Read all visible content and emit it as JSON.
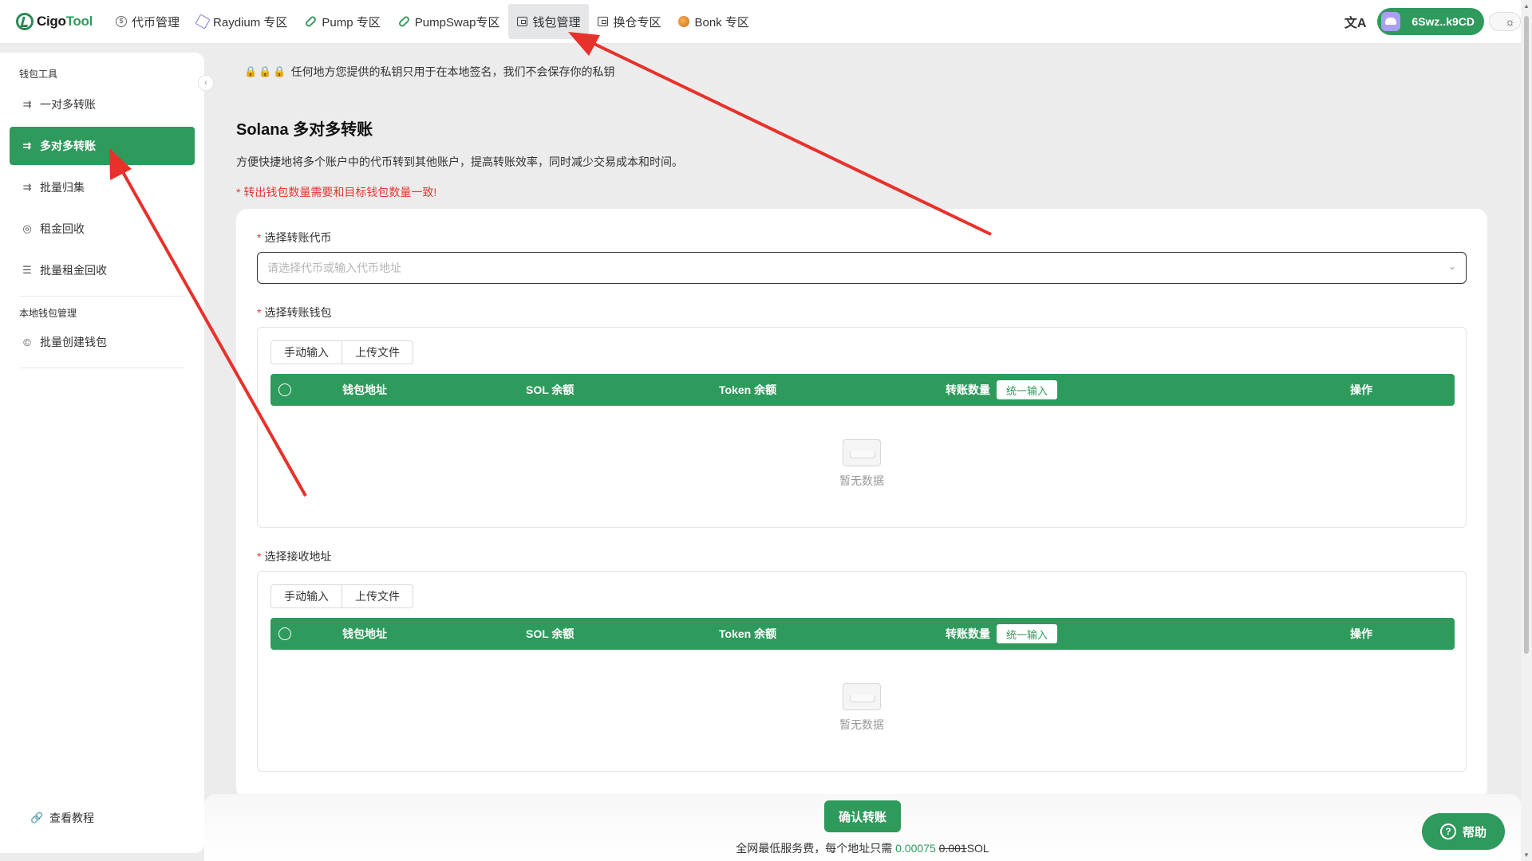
{
  "app": {
    "logo_part1": "Cigo",
    "logo_part2": "Tool"
  },
  "nav": [
    {
      "label": "代币管理",
      "icon": "dollar-circle-icon"
    },
    {
      "label": "Raydium 专区",
      "icon": "raydium-icon"
    },
    {
      "label": "Pump 专区",
      "icon": "pill-icon"
    },
    {
      "label": "PumpSwap专区",
      "icon": "pill-icon"
    },
    {
      "label": "钱包管理",
      "icon": "wallet-icon",
      "active": true
    },
    {
      "label": "换仓专区",
      "icon": "wallet-icon"
    },
    {
      "label": "Bonk 专区",
      "icon": "bonk-icon"
    }
  ],
  "wallet": {
    "address": "6Swz..k9CD"
  },
  "sidebar": {
    "section1": "钱包工具",
    "items": [
      {
        "label": "一对多转账",
        "icon": "transfer-icon"
      },
      {
        "label": "多对多转账",
        "icon": "transfer-icon",
        "active": true
      },
      {
        "label": "批量归集",
        "icon": "transfer-icon"
      },
      {
        "label": "租金回收",
        "icon": "coin-icon"
      },
      {
        "label": "批量租金回收",
        "icon": "coins-icon"
      }
    ],
    "section2": "本地钱包管理",
    "items2": [
      {
        "label": "批量创建钱包",
        "icon": "coin-icon"
      }
    ],
    "bottom": "查看教程"
  },
  "notice": "任何地方您提供的私钥只用于在本地签名，我们不会保存你的私钥",
  "page": {
    "title": "Solana 多对多转账",
    "desc": "方便快捷地将多个账户中的代币转到其他账户，提高转账效率，同时减少交易成本和时间。",
    "warn": "* 转出钱包数量需要和目标钱包数量一致!"
  },
  "form": {
    "token_label": "选择转账代币",
    "token_placeholder": "请选择代币或输入代币地址",
    "from_label": "选择转账钱包",
    "to_label": "选择接收地址",
    "tab_manual": "手动输入",
    "tab_upload": "上传文件",
    "col_address": "钱包地址",
    "col_sol": "SOL 余额",
    "col_token": "Token 余额",
    "col_amount": "转账数量",
    "col_unify": "统一输入",
    "col_action": "操作",
    "empty": "暂无数据"
  },
  "footer": {
    "confirm": "确认转账",
    "fee_prefix": "全网最低服务费，每个地址只需",
    "fee_new": "0.00075",
    "fee_old": "0.001",
    "fee_unit": "SOL"
  },
  "help": "帮助",
  "colors": {
    "accent": "#2e9a5c",
    "warn": "#e53935",
    "annotation": "#e8312a"
  }
}
